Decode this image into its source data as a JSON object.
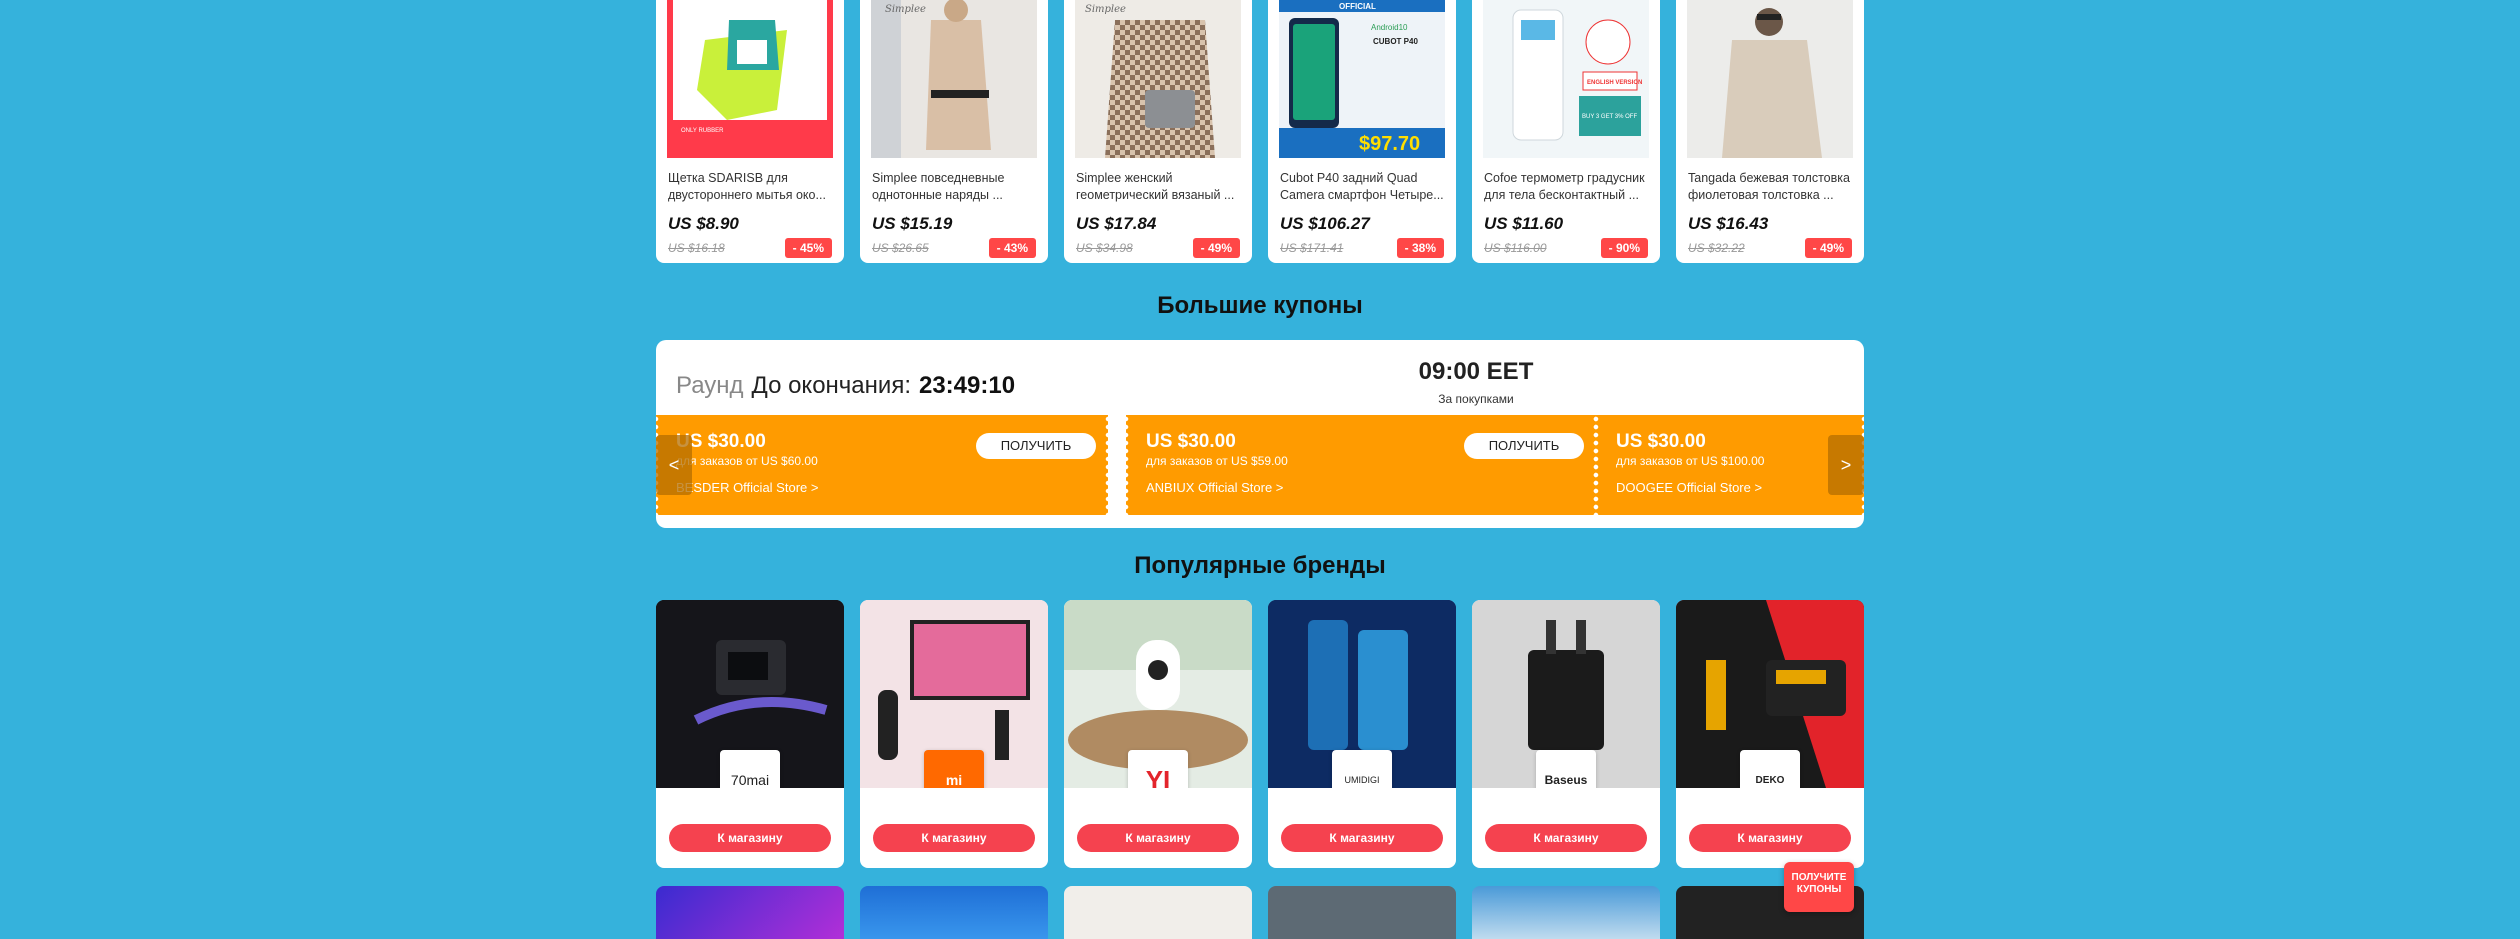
{
  "products": [
    {
      "title": "Щетка SDARISB для двустороннего мытья око...",
      "price": "US $8.90",
      "old_price": "US $16.18",
      "discount": "- 45%"
    },
    {
      "title": "Simplee повседневные однотонные наряды ...",
      "price": "US $15.19",
      "old_price": "US $26.65",
      "discount": "- 43%"
    },
    {
      "title": "Simplee женский геометрический вязаный ...",
      "price": "US $17.84",
      "old_price": "US $34.98",
      "discount": "- 49%"
    },
    {
      "title": "Cubot P40 задний Quad Camera смартфон Четыре...",
      "price": "US $106.27",
      "old_price": "US $171.41",
      "discount": "- 38%"
    },
    {
      "title": "Cofoe термометр градусник для тела бесконтактный ...",
      "price": "US $11.60",
      "old_price": "US $116.00",
      "discount": "- 90%"
    },
    {
      "title": "Tangada бежевая толстовка фиолетовая толстовка ...",
      "price": "US $16.43",
      "old_price": "US $32.22",
      "discount": "- 49%"
    }
  ],
  "product_image_texts": {
    "p1_badge": "ONLY RUBBER",
    "p2_brand": "Simplee",
    "p3_brand": "Simplee",
    "p4_top": "OFFICIAL",
    "p4_android": "Android10",
    "p4_model": "CUBOT P40",
    "p4_price": "$97.70",
    "p5_label": "ENGLISH VERSION",
    "p5_sale": "BUY 3 GET 3% OFF"
  },
  "coupons_section": {
    "title": "Большие купоны",
    "round_label": "Раунд",
    "until_label": "До окончания:",
    "countdown": "23:49:10",
    "next_time": "09:00 EET",
    "next_sub": "За покупками",
    "items": [
      {
        "amount": "US $30.00",
        "min": "для заказов от US $60.00",
        "store": "BESDER Official Store >",
        "button": "ПОЛУЧИТЬ"
      },
      {
        "amount": "US $30.00",
        "min": "для заказов от US $59.00",
        "store": "ANBIUX Official Store >",
        "button": "ПОЛУЧИТЬ"
      },
      {
        "amount": "US $30.00",
        "min": "для заказов от US $100.00",
        "store": "DOOGEE Official Store >",
        "button": ""
      }
    ],
    "prev_arrow": "<",
    "next_arrow": ">"
  },
  "brands_section": {
    "title": "Популярные бренды",
    "items": [
      {
        "logo": "70mai",
        "button": "К магазину"
      },
      {
        "logo": "mi",
        "button": "К магазину"
      },
      {
        "logo": "YI",
        "button": "К магазину"
      },
      {
        "logo": "UMIDIGI",
        "button": "К магазину"
      },
      {
        "logo": "Baseus",
        "button": "К магазину"
      },
      {
        "logo": "DEKO",
        "button": "К магазину"
      }
    ]
  },
  "floating_coupon": {
    "label": "ПОЛУЧИТЕ КУПОНЫ"
  },
  "colors": {
    "background": "#35b2dc",
    "coupon": "#ff9b00",
    "accent": "#ff4747"
  }
}
